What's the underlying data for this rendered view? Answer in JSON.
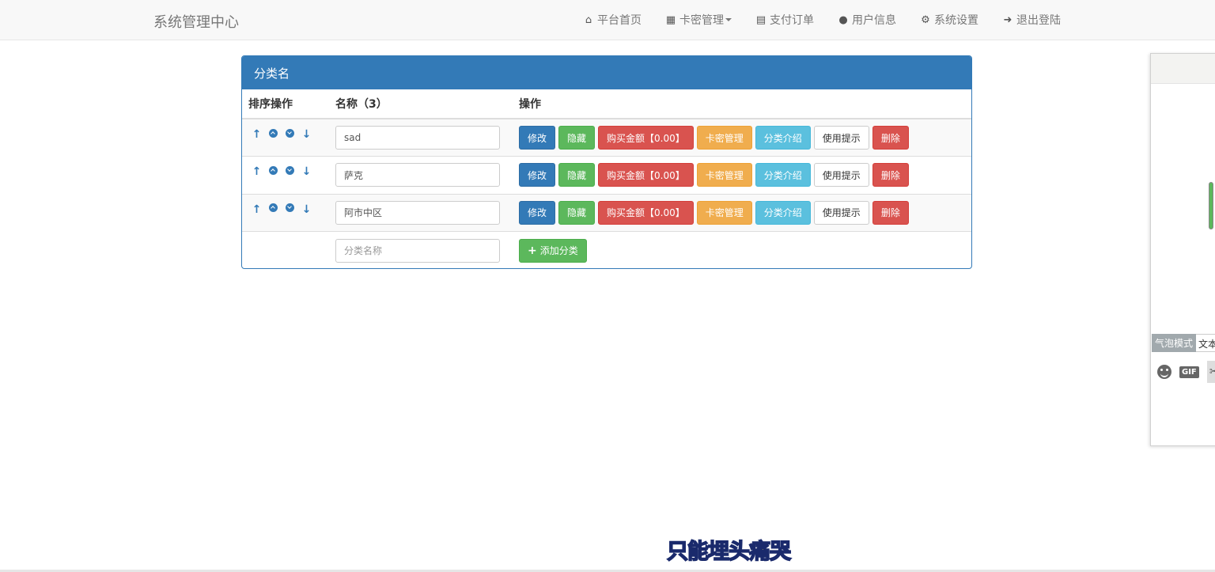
{
  "navbar": {
    "brand": "系统管理中心",
    "items": [
      {
        "label": "平台首页",
        "icon": "home-icon"
      },
      {
        "label": "卡密管理",
        "icon": "grid-icon",
        "dropdown": true
      },
      {
        "label": "支付订单",
        "icon": "card-icon"
      },
      {
        "label": "用户信息",
        "icon": "user-icon"
      },
      {
        "label": "系统设置",
        "icon": "gear-icon"
      },
      {
        "label": "退出登陆",
        "icon": "logout-icon"
      }
    ]
  },
  "panel": {
    "title": "分类名",
    "columns": {
      "sort": "排序操作",
      "name": "名称（3）",
      "actions": "操作"
    },
    "rows": [
      {
        "name": "sad"
      },
      {
        "name": "萨克"
      },
      {
        "name": "阿市中区"
      }
    ],
    "row_buttons": {
      "edit": "修改",
      "hide": "隐藏",
      "price": "购买金额【0.00】",
      "cards": "卡密管理",
      "intro": "分类介绍",
      "tips": "使用提示",
      "delete": "删除"
    },
    "new_category_placeholder": "分类名称",
    "add_button": "添加分类"
  },
  "widget": {
    "bubble_mode": "气泡模式",
    "text_mode": "文本",
    "gif_label": "GIF"
  },
  "subtitle": "只能埋头痛哭",
  "colors": {
    "primary": "#337ab7",
    "success": "#5cb85c",
    "danger": "#d9534f",
    "warning": "#f0ad4e",
    "info": "#5bc0de"
  }
}
